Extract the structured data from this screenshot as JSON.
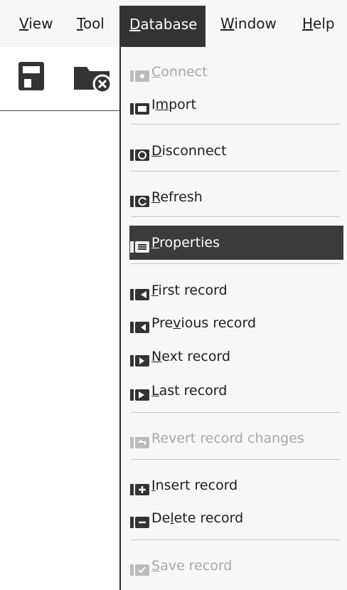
{
  "menubar": {
    "items": [
      {
        "label": "View",
        "mnemonic": "V",
        "rest": "iew"
      },
      {
        "label": "Tool",
        "mnemonic": "T",
        "rest": "ool"
      },
      {
        "label": "Database",
        "mnemonic": "D",
        "rest": "atabase"
      },
      {
        "label": "Window",
        "mnemonic": "W",
        "rest": "indow"
      },
      {
        "label": "Help",
        "mnemonic": "H",
        "rest": "elp"
      }
    ]
  },
  "toolbar": {
    "icons": [
      "save-icon",
      "close-connection-icon"
    ]
  },
  "database_menu": {
    "items": [
      {
        "pre": "",
        "mn": "C",
        "post": "onnect",
        "enabled": false,
        "icon": "connect-icon"
      },
      {
        "pre": "I",
        "mn": "m",
        "post": "port",
        "enabled": true,
        "icon": "import-icon"
      },
      {
        "pre": "",
        "mn": "D",
        "post": "isconnect",
        "enabled": true,
        "icon": "disconnect-icon"
      },
      {
        "pre": "",
        "mn": "R",
        "post": "efresh",
        "enabled": true,
        "icon": "refresh-icon"
      },
      {
        "pre": "",
        "mn": "P",
        "post": "roperties",
        "enabled": true,
        "icon": "properties-icon",
        "highlighted": true
      },
      {
        "pre": "",
        "mn": "F",
        "post": "irst record",
        "enabled": true,
        "icon": "first-record-icon"
      },
      {
        "pre": "Pre",
        "mn": "v",
        "post": "ious record",
        "enabled": true,
        "icon": "previous-record-icon"
      },
      {
        "pre": "",
        "mn": "N",
        "post": "ext record",
        "enabled": true,
        "icon": "next-record-icon"
      },
      {
        "pre": "",
        "mn": "L",
        "post": "ast record",
        "enabled": true,
        "icon": "last-record-icon"
      },
      {
        "pre": "Revert record changes",
        "mn": "",
        "post": "",
        "enabled": false,
        "icon": "revert-record-icon"
      },
      {
        "pre": "",
        "mn": "I",
        "post": "nsert record",
        "enabled": true,
        "icon": "insert-record-icon"
      },
      {
        "pre": "De",
        "mn": "l",
        "post": "ete record",
        "enabled": true,
        "icon": "delete-record-icon"
      },
      {
        "pre": "",
        "mn": "S",
        "post": "ave record",
        "enabled": false,
        "icon": "save-record-icon"
      }
    ]
  }
}
